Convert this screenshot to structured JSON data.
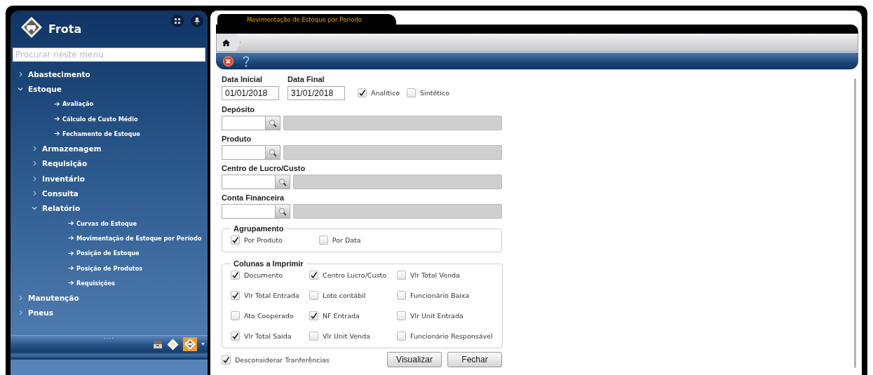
{
  "sidebar": {
    "title": "Frota",
    "search": {
      "placeholder": "Procurar neste menu"
    },
    "items": [
      {
        "kind": "group",
        "label": "Abastecimento",
        "expanded": false
      },
      {
        "kind": "group",
        "label": "Estoque",
        "expanded": true,
        "children": [
          {
            "kind": "leaf",
            "label": "Avaliação"
          },
          {
            "kind": "leaf",
            "label": "Cálculo de Custo Médio"
          },
          {
            "kind": "leaf",
            "label": "Fechamento de Estoque"
          },
          {
            "kind": "group",
            "label": "Armazenagem",
            "expanded": false
          },
          {
            "kind": "group",
            "label": "Requisição",
            "expanded": false
          },
          {
            "kind": "group",
            "label": "Inventário",
            "expanded": false
          },
          {
            "kind": "group",
            "label": "Consulta",
            "expanded": false
          },
          {
            "kind": "group",
            "label": "Relatório",
            "expanded": true,
            "children": [
              {
                "kind": "leaf",
                "label": "Curvas do Estoque"
              },
              {
                "kind": "leaf",
                "label": "Movimentação de Estoque por Período"
              },
              {
                "kind": "leaf",
                "label": "Posição de Estoque"
              },
              {
                "kind": "leaf",
                "label": "Posição de Produtos"
              },
              {
                "kind": "leaf",
                "label": "Requisições"
              }
            ]
          }
        ]
      },
      {
        "kind": "group",
        "label": "Manutenção",
        "expanded": false
      },
      {
        "kind": "group",
        "label": "Pneus",
        "expanded": false
      }
    ],
    "footer_handle": "...."
  },
  "tab": {
    "label": "Movimentação de Estoque por Período",
    "selected": true
  },
  "form": {
    "date_fields": [
      {
        "label": "Data Inicial",
        "value": "01/01/2018"
      },
      {
        "label": "Data Final",
        "value": "31/01/2018"
      }
    ],
    "mode_options": [
      {
        "label": "Analítico",
        "checked": true
      },
      {
        "label": "Sintético",
        "checked": false
      }
    ],
    "lookups": [
      {
        "label": "Depósito"
      },
      {
        "label": "Produto"
      },
      {
        "label": "Centro de Lucro/Custo"
      },
      {
        "label": "Conta Financeira"
      }
    ],
    "grouping": {
      "title": "Agrupamento",
      "options": [
        {
          "label": "Por Produto",
          "checked": true
        },
        {
          "label": "Por Data",
          "checked": false
        }
      ]
    },
    "columns": {
      "title": "Colunas a Imprimir",
      "options": [
        {
          "label": "Documento",
          "checked": true
        },
        {
          "label": "Centro Lucro/Custo",
          "checked": true
        },
        {
          "label": "Vlr Total Venda",
          "checked": false
        },
        {
          "label": "Vlr Total Entrada",
          "checked": true
        },
        {
          "label": "Lote contábil",
          "checked": false
        },
        {
          "label": "Funcionário Baixa",
          "checked": false
        },
        {
          "label": "Ato Cooperado",
          "checked": false
        },
        {
          "label": "NF Entrada",
          "checked": true
        },
        {
          "label": "Vlr Unit Entrada",
          "checked": false
        },
        {
          "label": "Vlr Total Saída",
          "checked": true
        },
        {
          "label": "Vlr Unit Venda",
          "checked": false
        },
        {
          "label": "Funcionário Responsável",
          "checked": false
        }
      ]
    },
    "ignore_transfers": {
      "label": "Desconsiderar Tranferências",
      "checked": true
    },
    "buttons": [
      {
        "label": "Visualizar"
      },
      {
        "label": "Fechar"
      }
    ]
  }
}
